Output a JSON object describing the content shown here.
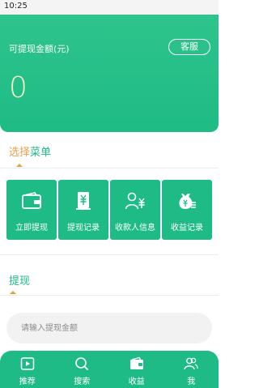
{
  "status_bar": {
    "time": "10:25"
  },
  "hero": {
    "label": "可提现金额(元)",
    "service_button": "客服",
    "amount": "0"
  },
  "menu_section": {
    "title_accent": "选择",
    "title_rest": "菜单",
    "items": [
      {
        "label": "立即提现",
        "icon": "wallet-icon"
      },
      {
        "label": "提现记录",
        "icon": "yuan-receipt-icon"
      },
      {
        "label": "收款人信息",
        "icon": "user-yuan-icon"
      },
      {
        "label": "收益记录",
        "icon": "money-bag-icon"
      }
    ]
  },
  "withdraw_section": {
    "title": "提现",
    "input_placeholder": "请输入提现金额"
  },
  "tabbar": {
    "items": [
      {
        "label": "推荐",
        "icon": "play-icon"
      },
      {
        "label": "搜索",
        "icon": "search-icon"
      },
      {
        "label": "收益",
        "icon": "wallet-icon"
      },
      {
        "label": "我",
        "icon": "users-icon"
      }
    ]
  },
  "colors": {
    "primary": "#1fbb86",
    "accent": "#e7a04a"
  }
}
